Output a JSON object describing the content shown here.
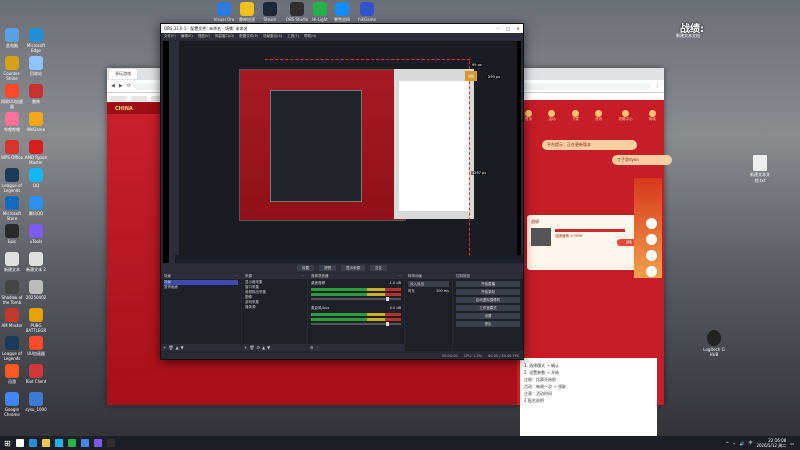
{
  "desktop": {
    "top_icons": [
      {
        "label": "Visual Ora",
        "color": "#2c7be5"
      },
      {
        "label": "雷神加速",
        "color": "#f1c21b"
      },
      {
        "label": "Steam",
        "color": "#1b2838"
      },
      {
        "label": "OBS Studio",
        "color": "#302e31"
      },
      {
        "label": "Hi-Light",
        "color": "#25b24a"
      },
      {
        "label": "暴雪战网",
        "color": "#148eff"
      },
      {
        "label": "hlkGame",
        "color": "#3355cc"
      }
    ],
    "left_icons": [
      {
        "label": "此电脑",
        "color": "#5aa0e6"
      },
      {
        "label": "Microsoft Edge",
        "color": "#1f8fd6"
      },
      {
        "label": "Counter-Strike",
        "color": "#d4a016"
      },
      {
        "label": "回收站",
        "color": "#8ec5ff"
      },
      {
        "label": "网易UU加速器",
        "color": "#ff4a2a"
      },
      {
        "label": "雷神",
        "color": "#c93030"
      },
      {
        "label": "哔哩哔哩",
        "color": "#fb7299"
      },
      {
        "label": "WeGame",
        "color": "#f3a712"
      },
      {
        "label": "WPS Office",
        "color": "#d7342d"
      },
      {
        "label": "AMD Ryzen Master",
        "color": "#d61f1f"
      },
      {
        "label": "League of Legends",
        "color": "#1c3b58"
      },
      {
        "label": "QQ",
        "color": "#12b7f5"
      },
      {
        "label": "Microsoft Store",
        "color": "#0f6cbd"
      },
      {
        "label": "腾讯QQ",
        "color": "#2c8eed"
      },
      {
        "label": "Epic",
        "color": "#2a2a2a"
      },
      {
        "label": "uTools",
        "color": "#7a5cf2"
      },
      {
        "label": "新建文本",
        "color": "#e0e0e0"
      },
      {
        "label": "新建文本 2",
        "color": "#e0e0e0"
      },
      {
        "label": "Shadow of the Tomb",
        "color": "#444"
      },
      {
        "label": "20250402",
        "color": "#bbb"
      },
      {
        "label": "AM Master",
        "color": "#c0392b"
      },
      {
        "label": "PUBG BATTLEGR",
        "color": "#e8a200"
      },
      {
        "label": "League of Legends",
        "color": "#1c3b58"
      },
      {
        "label": "UU加速器",
        "color": "#ff4a2a"
      },
      {
        "label": "迅游",
        "color": "#ff5722"
      },
      {
        "label": "Riot Client",
        "color": "#d13639"
      },
      {
        "label": "Google Chrome",
        "color": "#4285f4"
      },
      {
        "label": "sysu_1000",
        "color": "#3a7bd5"
      }
    ],
    "right_top_label": "战绩:",
    "right_top_sub": "新建文本文档",
    "right_icons": [
      {
        "label": "新建文本文档.txt"
      },
      {
        "label": "Logitech G HUB"
      }
    ]
  },
  "browser": {
    "tab_label": "多玩游戏",
    "site_logo": "CHINA",
    "nav": [
      "首页",
      "活动",
      "下载",
      "资讯",
      "攻略中心",
      "商城"
    ],
    "pills": [
      "平台提示：正在更新版本",
      "丁子里dyon"
    ],
    "card_title": "战绩",
    "card_item": "战团道具 ×7999",
    "card_btn": "领取",
    "side_text_lines": [
      "1. 选择模式 → 确认",
      "2. 设置参数 → 开始",
      "注册：比赛开始前",
      "活动：每周一次 → 领取",
      "注意：活动时间",
      "2 报名说明"
    ]
  },
  "obs": {
    "title": "OBS 31.0.1 - 配置文件: 未命名 - 场景: 未命名",
    "menu": [
      "文件(F)",
      "编辑(E)",
      "视图(V)",
      "停靠窗口(D)",
      "配置文件(P)",
      "场景集合(S)",
      "工具(T)",
      "帮助(H)"
    ],
    "preview_dims": {
      "top": "99 px",
      "right": "299 px",
      "height": "1267 px"
    },
    "gold_badge": "战绩",
    "modes": [
      "设置",
      "滤镜",
      "显示来源",
      "交互"
    ],
    "docks": {
      "scenes": {
        "header": "场景",
        "items": [
          "场景",
          "暂停画面"
        ]
      },
      "sources": {
        "header": "来源",
        "items": [
          "显示器采集",
          "窗口采集",
          "音频输出采集",
          "图像",
          "游戏采集",
          "媒体源"
        ]
      },
      "mixer": {
        "header": "音频混音器",
        "channels": [
          {
            "name": "桌面音频",
            "db": "-1.0 dB"
          },
          {
            "name": "麦克风/Aux",
            "db": "0.0 dB"
          }
        ]
      },
      "transitions": {
        "header": "转场动画",
        "type": "淡入淡出",
        "duration_label": "时长",
        "duration": "300 ms"
      },
      "controls": {
        "header": "控制按钮",
        "buttons": [
          "开始直播",
          "开始录制",
          "启动虚拟摄像机",
          "工作室模式",
          "设置",
          "退出"
        ]
      }
    },
    "status": {
      "rec": "00:00:00",
      "cpu": "CPU: 1.3%",
      "fps": "60.00 / 60.00 FPS"
    }
  },
  "taskbar": {
    "pinned_colors": [
      "#ffffff",
      "#1f8fd6",
      "#f7c948",
      "#12b7f5",
      "#25b24a",
      "#4285f4",
      "#7a5cf2",
      "#302e31"
    ],
    "time": "22:16:08",
    "date": "2026/5/12 周二",
    "ime": "中"
  }
}
